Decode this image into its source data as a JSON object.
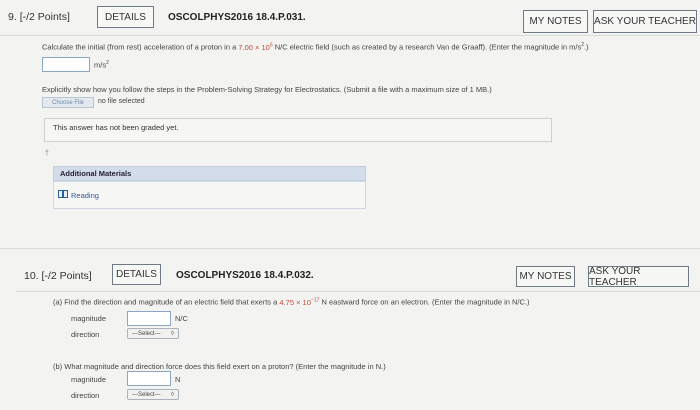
{
  "q9": {
    "number": "9.",
    "points": "[-/2 Points]",
    "details_label": "DETAILS",
    "code": "OSCOLPHYS2016 18.4.P.031.",
    "my_notes_label": "MY NOTES",
    "ask_teacher_label": "ASK YOUR TEACHER",
    "prompt_a": "Calculate the initial (from rest) acceleration of a proton in a",
    "prompt_value": "7.00 × 10",
    "prompt_exp": "6",
    "prompt_b": "N/C electric field (such as created by a research Van de Graaff). (Enter the magnitude in m/s",
    "prompt_b_sup": "2",
    "prompt_b_end": ".)",
    "answer_unit": "m/s",
    "answer_unit_sup": "2",
    "explain": "Explicitly show how you follow the steps in the Problem-Solving Strategy for Electrostatics. (Submit a file with a maximum size of 1 MB.)",
    "choose_file_label": "Choose File",
    "no_file_text": "no file selected",
    "graded_text": "This answer has not been graded yet.",
    "marker": "†",
    "additional_materials": "Additional Materials",
    "reading_label": "Reading"
  },
  "q10": {
    "number": "10.",
    "points": "[-/2 Points]",
    "details_label": "DETAILS",
    "code": "OSCOLPHYS2016 18.4.P.032.",
    "my_notes_label": "MY NOTES",
    "ask_teacher_label": "ASK YOUR TEACHER",
    "part_a_label": "(a)",
    "part_a_text_1": "Find the direction and magnitude of an electric field that exerts a",
    "part_a_value": "4.75 × 10",
    "part_a_exp": "−17",
    "part_a_text_2": "N eastward force on an electron. (Enter the magnitude in N/C.)",
    "magnitude_label": "magnitude",
    "unit_a": "N/C",
    "direction_label": "direction",
    "select_placeholder": "---Select---",
    "part_b_label": "(b)",
    "part_b_text": "What magnitude and direction force does this field exert on a proton? (Enter the magnitude in N.)",
    "unit_b": "N"
  }
}
